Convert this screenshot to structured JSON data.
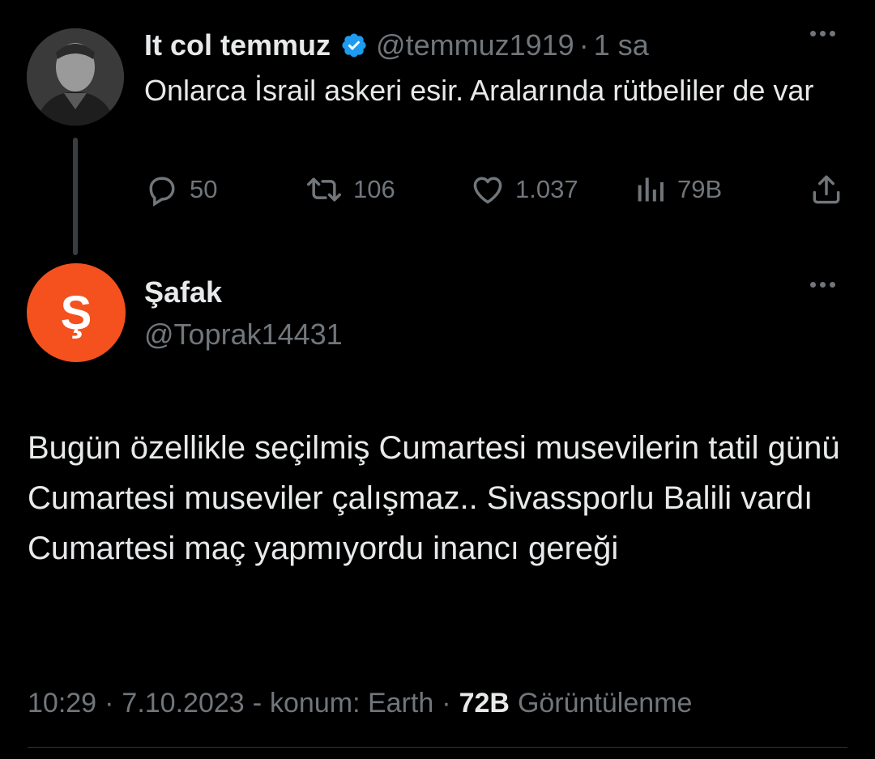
{
  "parent_tweet": {
    "display_name": "It col temmuz",
    "handle": "@temmuz1919",
    "separator": "·",
    "time": "1 sa",
    "text": "Onlarca İsrail askeri esir. Aralarında rütbeliler de var",
    "actions": {
      "reply_count": "50",
      "retweet_count": "106",
      "like_count": "1.037",
      "views_count": "79B"
    },
    "verified_color": "#1d9bf0"
  },
  "main_tweet": {
    "avatar_letter": "Ş",
    "avatar_color": "#f4511e",
    "display_name": "Şafak",
    "handle": "@Toprak14431",
    "text": "Bugün özellikle seçilmiş Cumartesi musevilerin tatil günü Cumartesi museviler çalışmaz.. Sivassporlu Balili vardı Cumartesi maç yapmıyordu inancı gereği",
    "meta": {
      "time": "10:29",
      "date": "7.10.2023",
      "location": "konum: Earth",
      "views_count": "72B",
      "views_label": "Görüntülenme",
      "dot": "·",
      "dash": "-"
    }
  },
  "icons": {
    "reply": "reply-icon",
    "retweet": "retweet-icon",
    "like": "heart-icon",
    "views": "views-icon",
    "share": "share-icon",
    "more": "more-icon",
    "verified": "verified-badge-icon"
  }
}
